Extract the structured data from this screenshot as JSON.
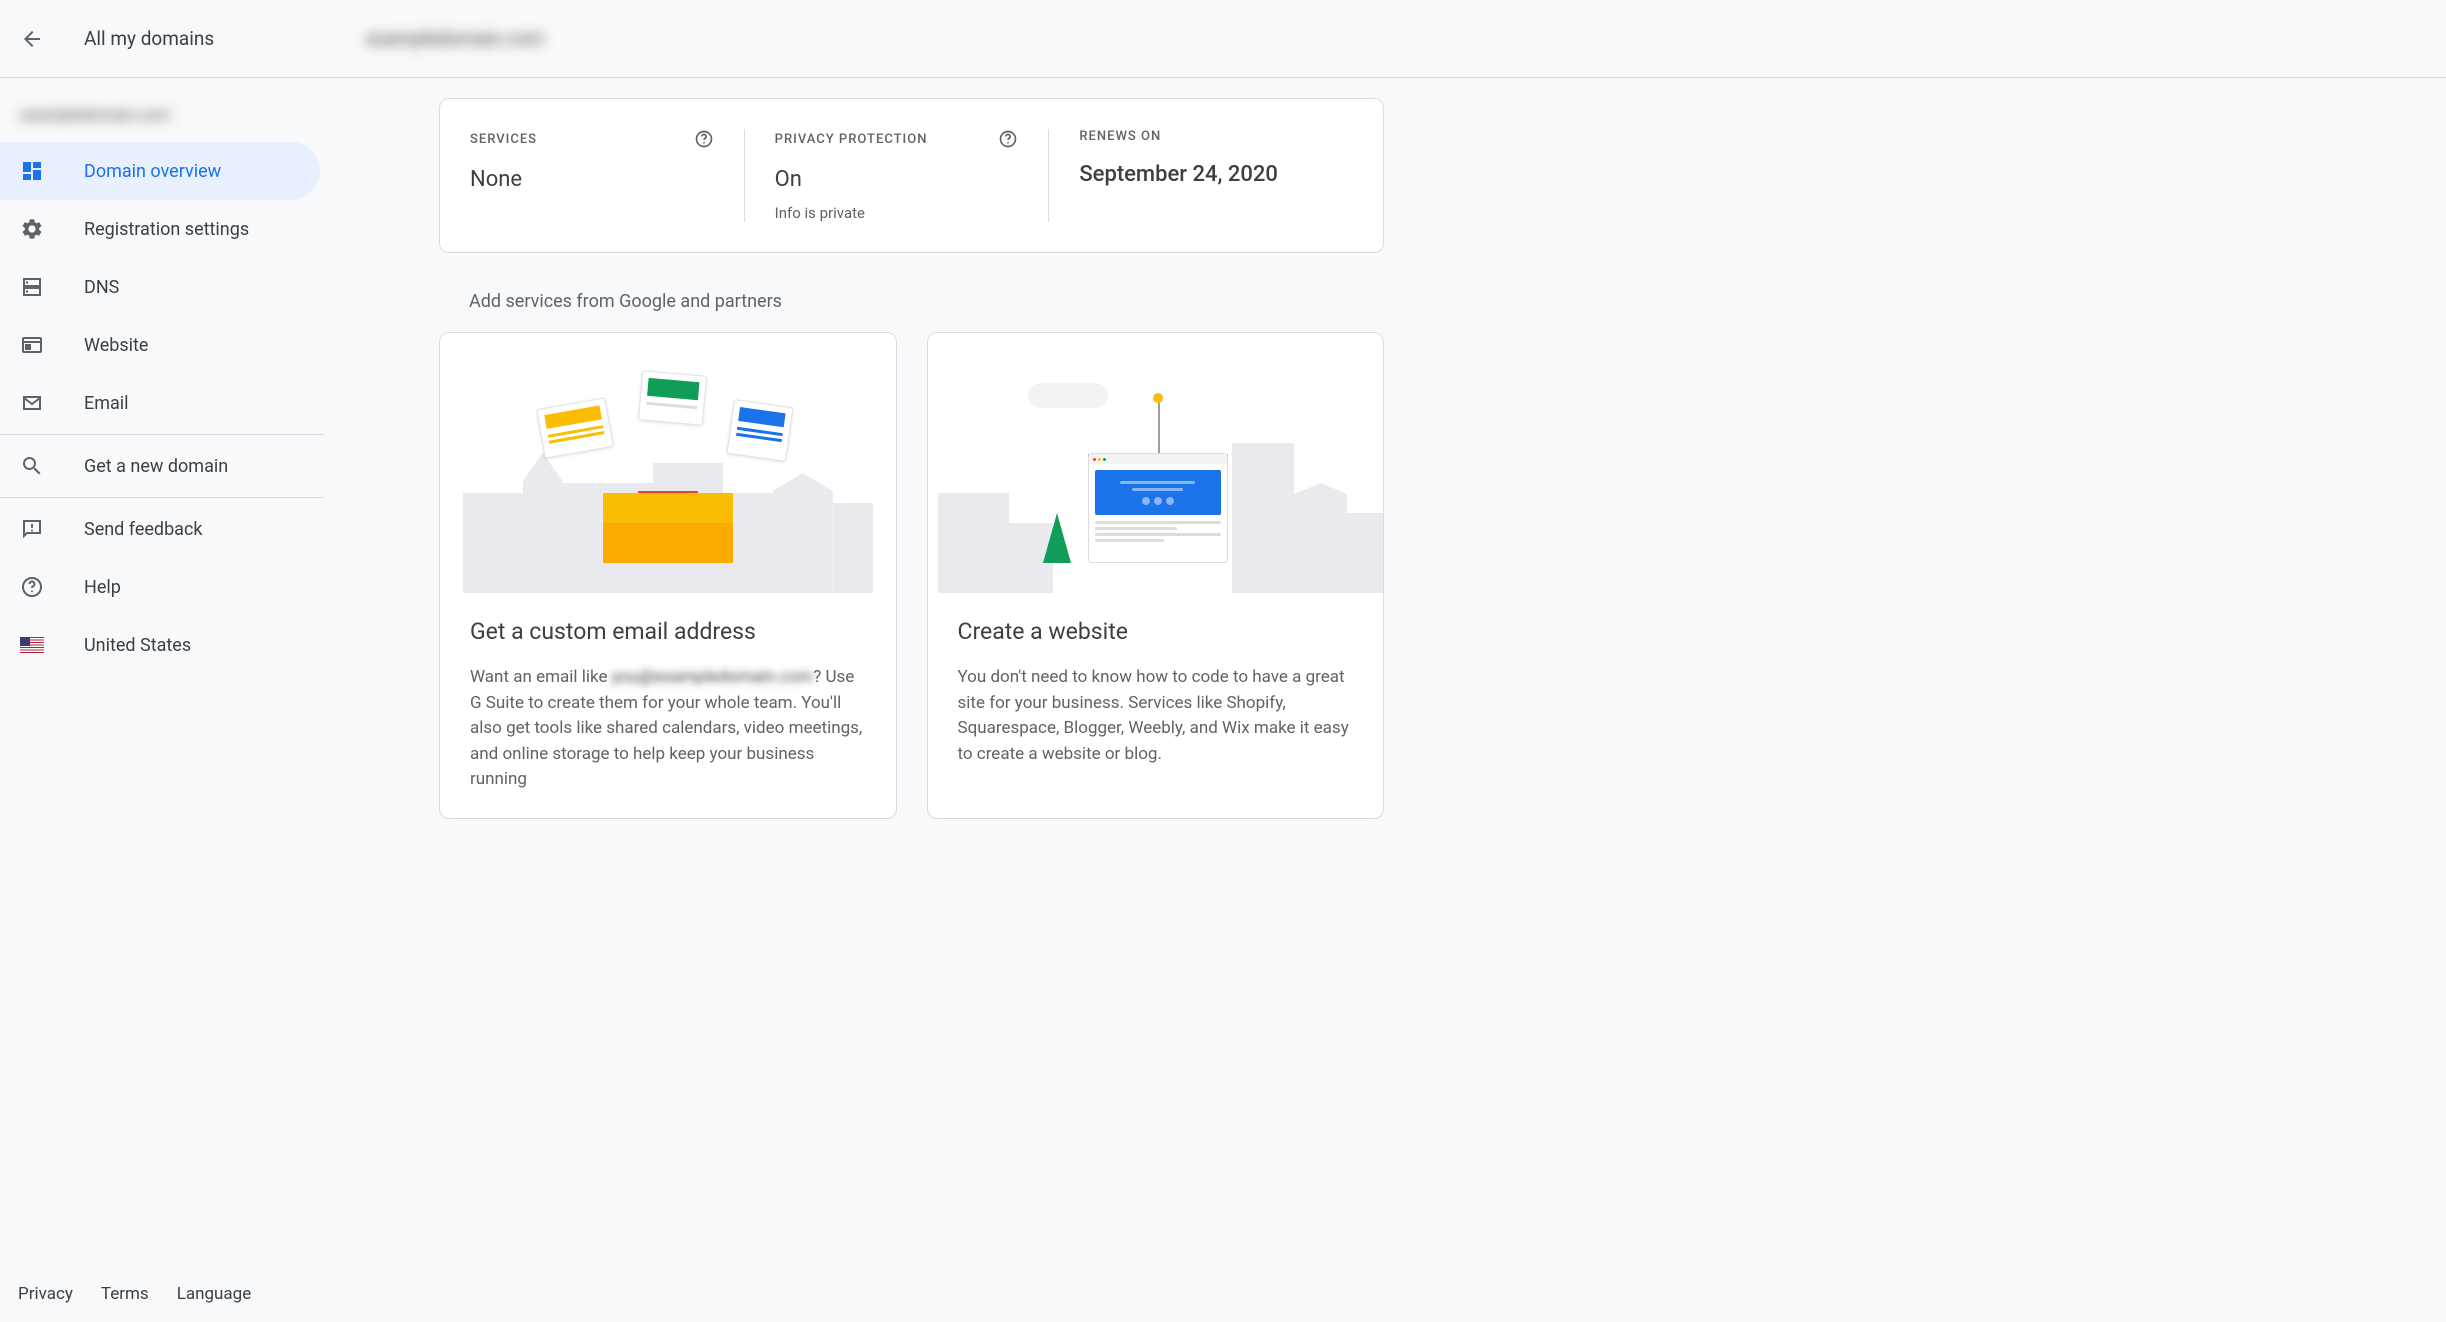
{
  "topbar": {
    "back_title": "All my domains",
    "domain_blurred": "exampledomain.com"
  },
  "sidebar": {
    "domain_blurred": "exampledomain.com",
    "items": [
      {
        "label": "Domain overview"
      },
      {
        "label": "Registration settings"
      },
      {
        "label": "DNS"
      },
      {
        "label": "Website"
      },
      {
        "label": "Email"
      }
    ],
    "get_domain": "Get a new domain",
    "feedback": "Send feedback",
    "help": "Help",
    "country": "United States"
  },
  "footer": {
    "privacy": "Privacy",
    "terms": "Terms",
    "language": "Language"
  },
  "info": {
    "services": {
      "label": "SERVICES",
      "value": "None"
    },
    "privacy": {
      "label": "PRIVACY PROTECTION",
      "value": "On",
      "sub": "Info is private"
    },
    "renews": {
      "label": "RENEWS ON",
      "value": "September 24, 2020"
    }
  },
  "services_heading": "Add services from Google and partners",
  "cards": {
    "email": {
      "title": "Get a custom email address",
      "text_pre": "Want an email like ",
      "text_blurred": "you@exampledomain.com",
      "text_post": "? Use G Suite to create them for your whole team. You'll also get tools like shared calendars, video meetings, and online storage to help keep your business running"
    },
    "website": {
      "title": "Create a website",
      "text": "You don't need to know how to code to have a great site for your business. Services like Shopify, Squarespace, Blogger, Weebly, and Wix make it easy to create a website or blog."
    }
  }
}
